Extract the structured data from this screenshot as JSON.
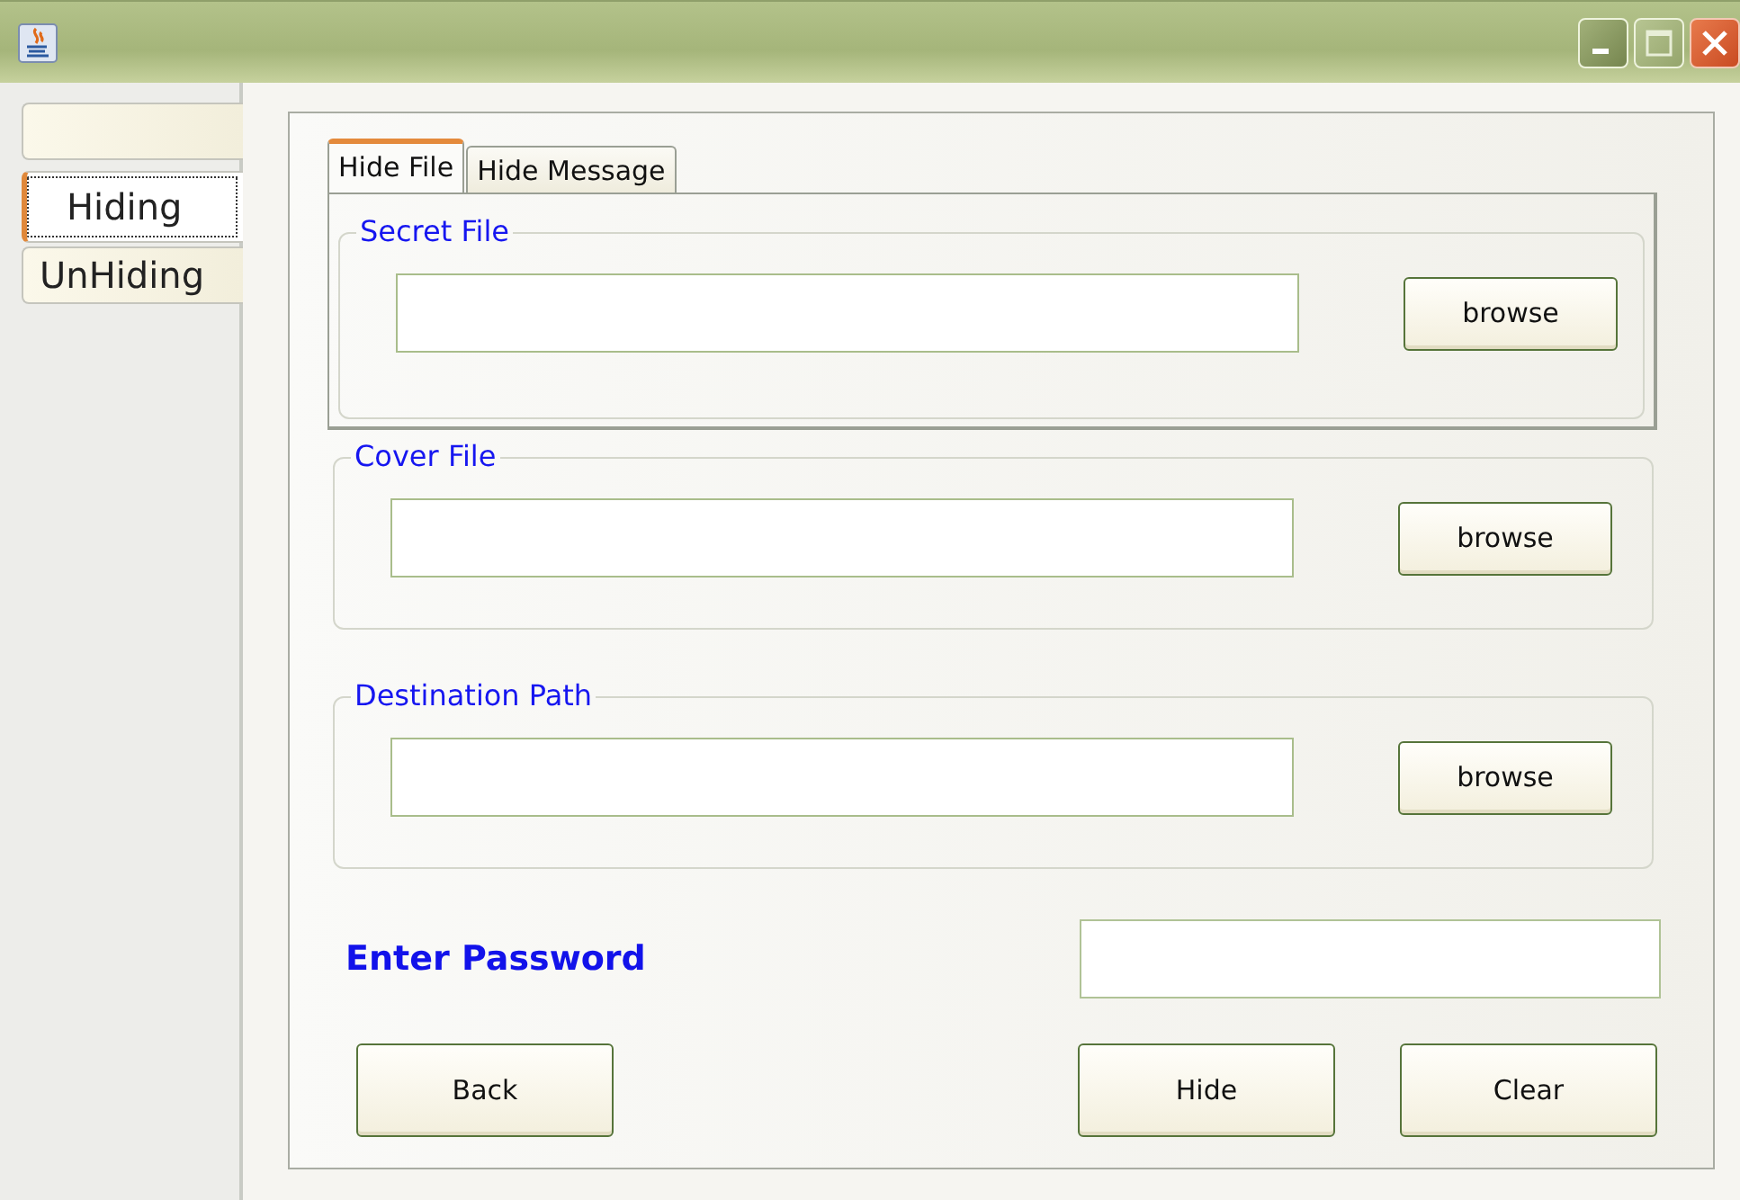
{
  "side_tabs": [
    {
      "kind": "blank",
      "selected": false
    },
    {
      "kind": "tab",
      "label": "Hiding",
      "selected": true
    },
    {
      "kind": "tab",
      "label": "UnHiding",
      "selected": false
    }
  ],
  "tabs": [
    {
      "label": "Hide File",
      "selected": true
    },
    {
      "label": "Hide Message",
      "selected": false
    }
  ],
  "tab_panel": {
    "groups": [
      {
        "legend": "Secret File",
        "button": "browse"
      }
    ]
  },
  "groups": [
    {
      "legend": "Cover File",
      "button": "browse"
    },
    {
      "legend": "Destination Path",
      "button": "browse"
    }
  ],
  "password": {
    "label": "Enter Password"
  },
  "buttons_left": [
    "Back"
  ],
  "buttons_right": [
    "Hide",
    "Clear"
  ]
}
